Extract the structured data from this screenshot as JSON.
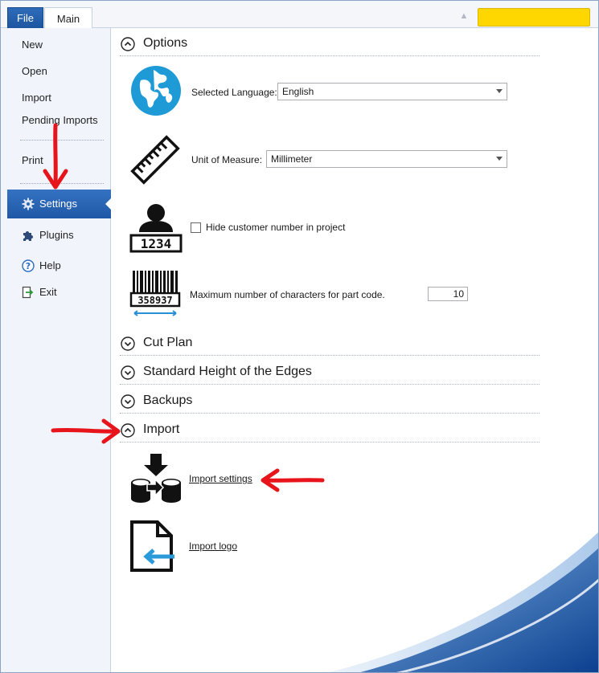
{
  "ribbon": {
    "tabs": [
      {
        "label": "File",
        "active": true
      },
      {
        "label": "Main",
        "active": false
      }
    ],
    "collapse_glyph": "▲",
    "highlight_color": "#FFD700"
  },
  "sidebar": {
    "items": [
      {
        "label": "New"
      },
      {
        "label": "Open"
      },
      {
        "label": "Import"
      },
      {
        "label": "Pending Imports"
      },
      {
        "label": "Print"
      },
      {
        "label": "Settings",
        "icon": "gear-icon",
        "selected": true
      },
      {
        "label": "Plugins",
        "icon": "puzzle-icon"
      },
      {
        "label": "Help",
        "icon": "help-icon"
      },
      {
        "label": "Exit",
        "icon": "exit-icon"
      }
    ]
  },
  "sections": {
    "options": {
      "title": "Options",
      "expanded": true,
      "language": {
        "label": "Selected Language:",
        "value": "English",
        "icon": "globe-icon"
      },
      "unit": {
        "label": "Unit of Measure:",
        "value": "Millimeter",
        "icon": "ruler-icon"
      },
      "customer": {
        "label": "Hide customer number in project",
        "checked": false,
        "icon": "customer-number-icon",
        "icon_text": "1234"
      },
      "partcode": {
        "label": "Maximum number of characters for part code.",
        "value": "10",
        "icon": "barcode-icon",
        "icon_text": "358937"
      }
    },
    "cut_plan": {
      "title": "Cut Plan",
      "expanded": false
    },
    "edge_height": {
      "title": "Standard Height of the Edges",
      "expanded": false
    },
    "backups": {
      "title": "Backups",
      "expanded": false
    },
    "import": {
      "title": "Import",
      "expanded": true,
      "settings_link": "Import settings",
      "logo_link": "Import logo"
    }
  },
  "annotations": {
    "arrow_color": "#E8141B"
  }
}
